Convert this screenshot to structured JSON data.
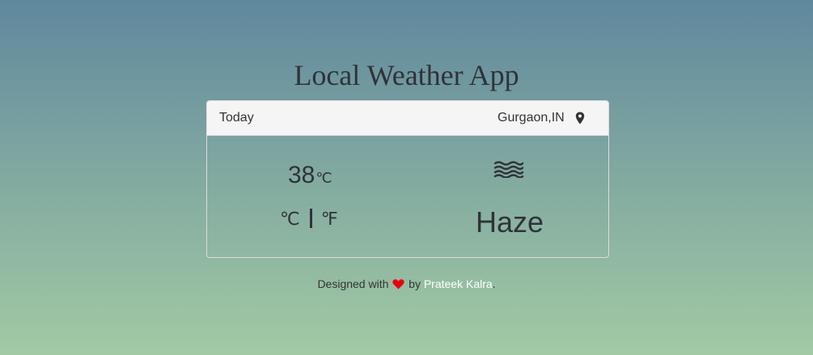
{
  "app": {
    "title": "Local Weather App"
  },
  "card": {
    "day_label": "Today",
    "location": "Gurgaon,IN",
    "location_icon": "map-pin-icon",
    "temperature": {
      "value": "38",
      "unit": "℃"
    },
    "unit_toggle": {
      "celsius": "℃",
      "fahrenheit": "℉"
    },
    "weather_icon": "haze-icon",
    "condition": "Haze"
  },
  "footer": {
    "prefix": "Designed with",
    "heart_icon": "heart-icon",
    "by": "by",
    "author": "Prateek Kalra",
    "suffix": "."
  },
  "colors": {
    "bg_top": "#5f889e",
    "bg_bottom": "#a2caa4",
    "heart": "#e8000d",
    "author_link": "#ffffff"
  }
}
